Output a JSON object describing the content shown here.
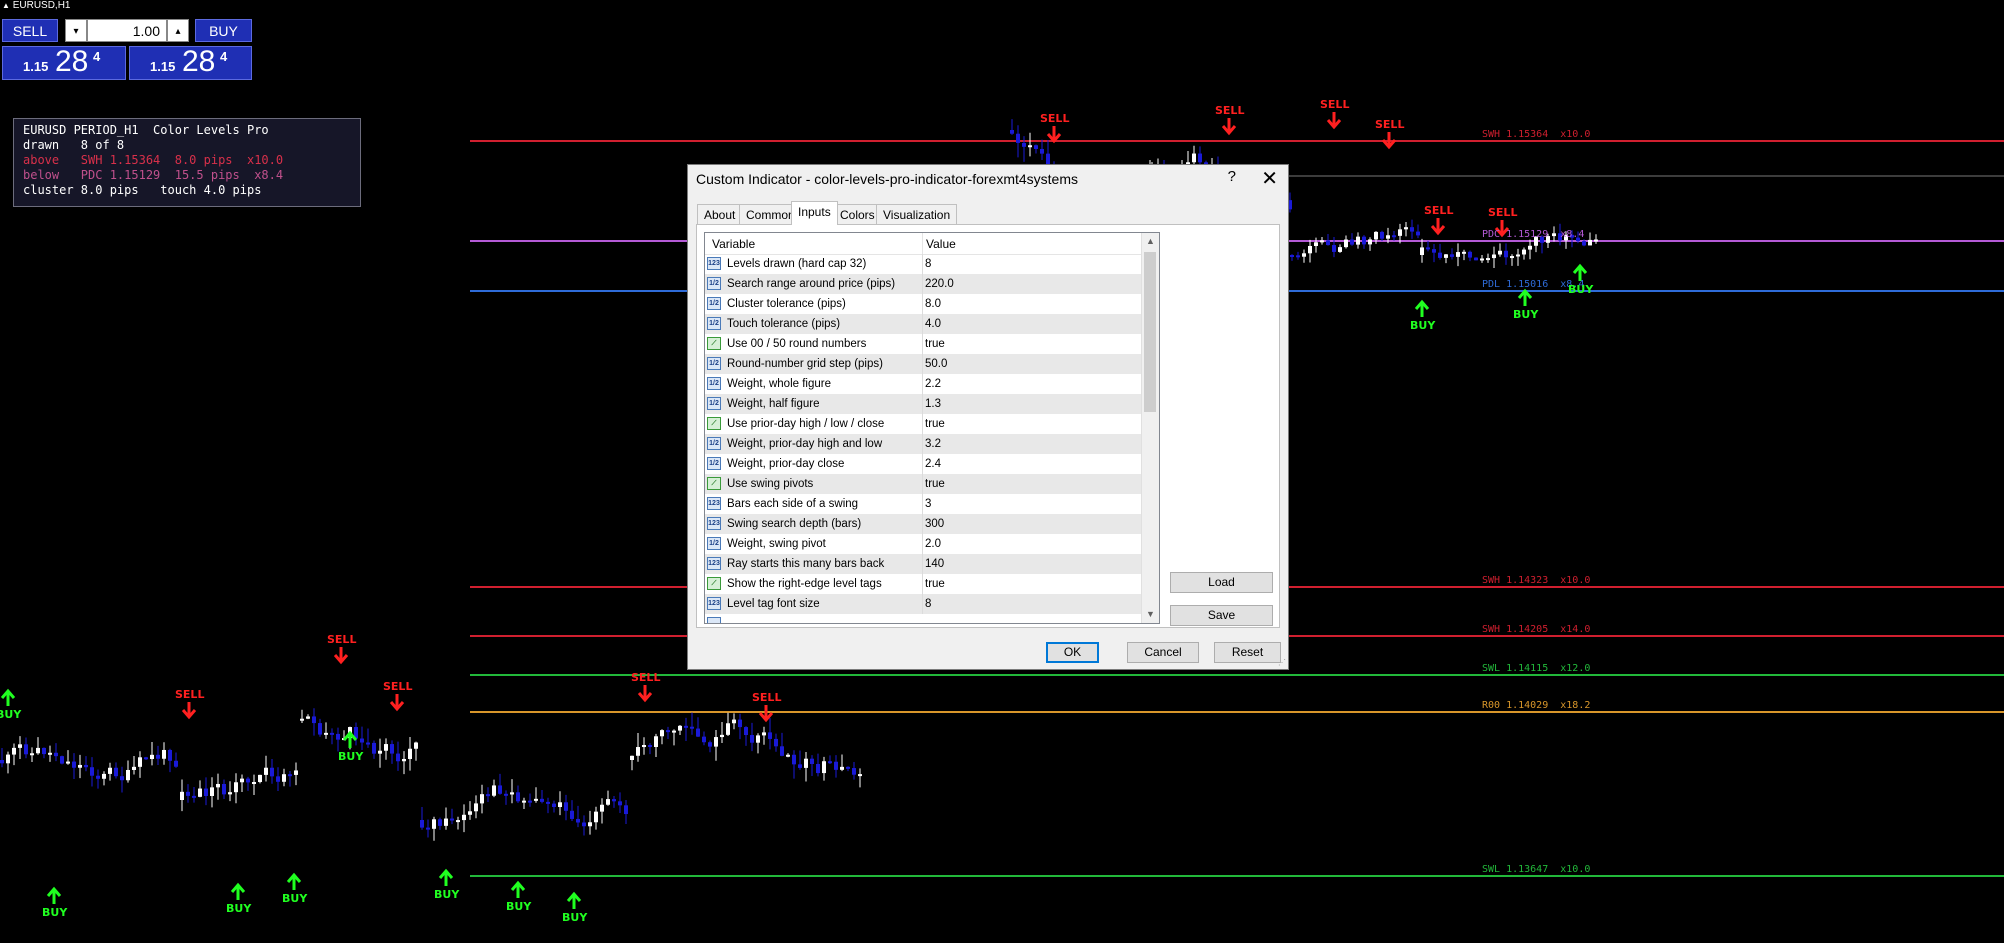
{
  "window": {
    "title": "EURUSD,H1"
  },
  "trade_panel": {
    "sell_label": "SELL",
    "buy_label": "BUY",
    "lot_value": "1.00",
    "sell_price": {
      "small": "1.15",
      "big": "28",
      "sup": "4"
    },
    "buy_price": {
      "small": "1.15",
      "big": "28",
      "sup": "4"
    }
  },
  "info_box": {
    "line1": "EURUSD PERIOD_H1  Color Levels Pro",
    "line2": "drawn   8 of 8",
    "line3": "above   SWH 1.15364  8.0 pips  x10.0",
    "line4": "below   PDC 1.15129  15.5 pips  x8.4",
    "line5": "cluster 8.0 pips   touch 4.0 pips"
  },
  "colors": {
    "red_level": "#d01f2f",
    "violet_level": "#b45ad6",
    "blue_level": "#2e6bd8",
    "green_level": "#22b83a",
    "orange_level": "#d8962a",
    "gray_line": "#777777",
    "bull_candle": "#ffffff",
    "bear_candle": "#1a1ad8",
    "sell_signal": "#ff2020",
    "buy_signal": "#20ff20",
    "panel_blue": "#1f2fb4"
  },
  "level_tags": [
    {
      "text": "SWH 1.15364  x10.0",
      "color": "#d01f2f"
    },
    {
      "text": "PDC 1.15129  x8.4",
      "color": "#b45ad6"
    },
    {
      "text": "PDL 1.15016  x8.4",
      "color": "#2e6bd8"
    },
    {
      "text": "SWH 1.14323  x10.0",
      "color": "#d01f2f"
    },
    {
      "text": "SWH 1.14205  x14.0",
      "color": "#d01f2f"
    },
    {
      "text": "SWL 1.14115  x12.0",
      "color": "#22b83a"
    },
    {
      "text": "R00 1.14029  x18.2",
      "color": "#d8962a"
    },
    {
      "text": "SWL 1.13647  x10.0",
      "color": "#22b83a"
    }
  ],
  "signal_labels": {
    "sell": "SELL",
    "buy": "BUY"
  },
  "dialog": {
    "title": "Custom Indicator - color-levels-pro-indicator-forexmt4systems",
    "help": "?",
    "close": "✕",
    "tabs": [
      "About",
      "Common",
      "Inputs",
      "Colors",
      "Visualization"
    ],
    "active_tab": "Inputs",
    "columns": {
      "variable": "Variable",
      "value": "Value"
    },
    "rows": [
      {
        "icon": "123",
        "name": "Levels drawn (hard cap 32)",
        "value": "8"
      },
      {
        "icon": "1/2",
        "name": "Search range around price (pips)",
        "value": "220.0"
      },
      {
        "icon": "1/2",
        "name": "Cluster tolerance (pips)",
        "value": "8.0"
      },
      {
        "icon": "1/2",
        "name": "Touch tolerance (pips)",
        "value": "4.0"
      },
      {
        "icon": "bool",
        "name": "Use 00 / 50 round numbers",
        "value": "true"
      },
      {
        "icon": "1/2",
        "name": "Round-number grid step (pips)",
        "value": "50.0"
      },
      {
        "icon": "1/2",
        "name": "Weight, whole figure",
        "value": "2.2"
      },
      {
        "icon": "1/2",
        "name": "Weight, half figure",
        "value": "1.3"
      },
      {
        "icon": "bool",
        "name": "Use prior-day high / low / close",
        "value": "true"
      },
      {
        "icon": "1/2",
        "name": "Weight, prior-day high and low",
        "value": "3.2"
      },
      {
        "icon": "1/2",
        "name": "Weight, prior-day close",
        "value": "2.4"
      },
      {
        "icon": "bool",
        "name": "Use swing pivots",
        "value": "true"
      },
      {
        "icon": "123",
        "name": "Bars each side of a swing",
        "value": "3"
      },
      {
        "icon": "123",
        "name": "Swing search depth (bars)",
        "value": "300"
      },
      {
        "icon": "1/2",
        "name": "Weight, swing pivot",
        "value": "2.0"
      },
      {
        "icon": "123",
        "name": "Ray starts this many bars back",
        "value": "140"
      },
      {
        "icon": "bool",
        "name": "Show the right-edge level tags",
        "value": "true"
      },
      {
        "icon": "123",
        "name": "Level tag font size",
        "value": "8"
      }
    ],
    "load_label": "Load",
    "save_label": "Save",
    "ok_label": "OK",
    "cancel_label": "Cancel",
    "reset_label": "Reset"
  }
}
